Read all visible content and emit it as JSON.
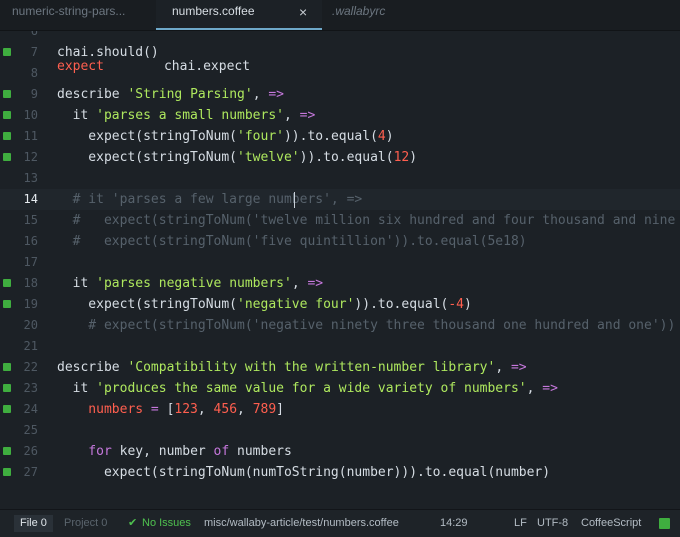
{
  "tabs": [
    {
      "label": "numeric-string-pars..."
    },
    {
      "label": "numbers.coffee",
      "close_icon": "×"
    },
    {
      "label": ".wallabyrc"
    }
  ],
  "partial_top_line": {
    "a": "expect",
    "b": "chai.expect"
  },
  "lines": [
    {
      "n": "6",
      "mark": false,
      "segs": []
    },
    {
      "n": "7",
      "mark": true,
      "segs": [
        [
          "plain",
          "chai.should()"
        ]
      ]
    },
    {
      "n": "8",
      "mark": false,
      "segs": []
    },
    {
      "n": "9",
      "mark": true,
      "segs": [
        [
          "plain",
          "describe "
        ],
        [
          "str",
          "'String Parsing'"
        ],
        [
          "plain",
          ", "
        ],
        [
          "kw",
          "=>"
        ]
      ]
    },
    {
      "n": "10",
      "mark": true,
      "segs": [
        [
          "plain",
          "  it "
        ],
        [
          "str",
          "'parses a small numbers'"
        ],
        [
          "plain",
          ", "
        ],
        [
          "kw",
          "=>"
        ]
      ]
    },
    {
      "n": "11",
      "mark": true,
      "segs": [
        [
          "plain",
          "    expect(stringToNum("
        ],
        [
          "str",
          "'four'"
        ],
        [
          "plain",
          ")).to.equal("
        ],
        [
          "numv",
          "4"
        ],
        [
          "plain",
          ")"
        ]
      ]
    },
    {
      "n": "12",
      "mark": true,
      "segs": [
        [
          "plain",
          "    expect(stringToNum("
        ],
        [
          "str",
          "'twelve'"
        ],
        [
          "plain",
          ")).to.equal("
        ],
        [
          "numv",
          "12"
        ],
        [
          "plain",
          ")"
        ]
      ]
    },
    {
      "n": "13",
      "mark": false,
      "segs": []
    },
    {
      "n": "14",
      "mark": false,
      "current": true,
      "segs": [
        [
          "cmt",
          "  # it 'parses a few large numbers', =>"
        ]
      ]
    },
    {
      "n": "15",
      "mark": false,
      "segs": [
        [
          "cmt",
          "  #   expect(stringToNum('twelve million six hundred and four thousand and nine"
        ]
      ]
    },
    {
      "n": "16",
      "mark": false,
      "segs": [
        [
          "cmt",
          "  #   expect(stringToNum('five quintillion')).to.equal(5e18)"
        ]
      ]
    },
    {
      "n": "17",
      "mark": false,
      "segs": []
    },
    {
      "n": "18",
      "mark": true,
      "segs": [
        [
          "plain",
          "  it "
        ],
        [
          "str",
          "'parses negative numbers'"
        ],
        [
          "plain",
          ", "
        ],
        [
          "kw",
          "=>"
        ]
      ]
    },
    {
      "n": "19",
      "mark": true,
      "segs": [
        [
          "plain",
          "    expect(stringToNum("
        ],
        [
          "str",
          "'negative four'"
        ],
        [
          "plain",
          ")).to.equal("
        ],
        [
          "numv",
          "-4"
        ],
        [
          "plain",
          ")"
        ]
      ]
    },
    {
      "n": "20",
      "mark": false,
      "segs": [
        [
          "cmt",
          "    # expect(stringToNum('negative ninety three thousand one hundred and one'))"
        ]
      ]
    },
    {
      "n": "21",
      "mark": false,
      "segs": []
    },
    {
      "n": "22",
      "mark": true,
      "segs": [
        [
          "plain",
          "describe "
        ],
        [
          "str",
          "'Compatibility with the written-number library'"
        ],
        [
          "plain",
          ", "
        ],
        [
          "kw",
          "=>"
        ]
      ]
    },
    {
      "n": "23",
      "mark": true,
      "segs": [
        [
          "plain",
          "  it "
        ],
        [
          "str",
          "'produces the same value for a wide variety of numbers'"
        ],
        [
          "plain",
          ", "
        ],
        [
          "kw",
          "=>"
        ]
      ]
    },
    {
      "n": "24",
      "mark": true,
      "segs": [
        [
          "var",
          "    numbers"
        ],
        [
          "plain",
          " "
        ],
        [
          "kw",
          "="
        ],
        [
          "plain",
          " ["
        ],
        [
          "numv",
          "123"
        ],
        [
          "plain",
          ", "
        ],
        [
          "numv",
          "456"
        ],
        [
          "plain",
          ", "
        ],
        [
          "numv",
          "789"
        ],
        [
          "plain",
          "]"
        ]
      ]
    },
    {
      "n": "25",
      "mark": false,
      "segs": []
    },
    {
      "n": "26",
      "mark": true,
      "segs": [
        [
          "kw",
          "    for"
        ],
        [
          "plain",
          " key, number "
        ],
        [
          "kw",
          "of"
        ],
        [
          "plain",
          " numbers"
        ]
      ]
    },
    {
      "n": "27",
      "mark": true,
      "segs": [
        [
          "plain",
          "      expect(stringToNum(numToString(number))).to.equal(number)"
        ]
      ]
    }
  ],
  "status": {
    "file": "File 0",
    "project": "Project 0",
    "issues_icon": "check-icon",
    "issues": "No Issues",
    "path": "misc/wallaby-article/test/numbers.coffee",
    "cursor": "14:29",
    "line_ending": "LF",
    "encoding": "UTF-8",
    "grammar": "CoffeeScript"
  }
}
